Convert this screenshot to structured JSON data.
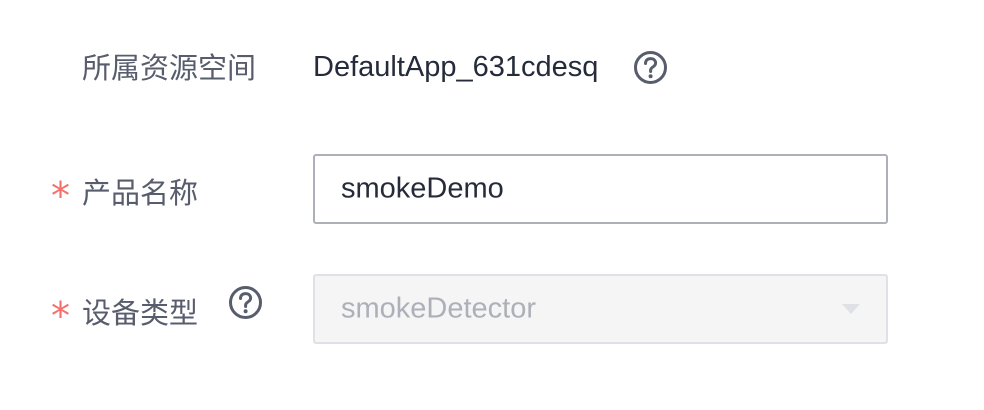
{
  "form": {
    "workspace": {
      "label": "所属资源空间",
      "value": "DefaultApp_631cdesq",
      "help_icon": "question-circle-icon"
    },
    "product_name": {
      "required_mark": "*",
      "label": "产品名称",
      "value": "smokeDemo"
    },
    "device_type": {
      "required_mark": "*",
      "label": "设备类型",
      "help_icon": "question-circle-icon",
      "selected": "smokeDetector",
      "dropdown_icon": "caret-down-icon"
    }
  },
  "colors": {
    "label": "#575d6c",
    "value": "#252b3a",
    "required": "#f66f6a",
    "input_border": "#adb0b8",
    "disabled_bg": "#f5f5f6",
    "disabled_text": "#adb0b8"
  }
}
